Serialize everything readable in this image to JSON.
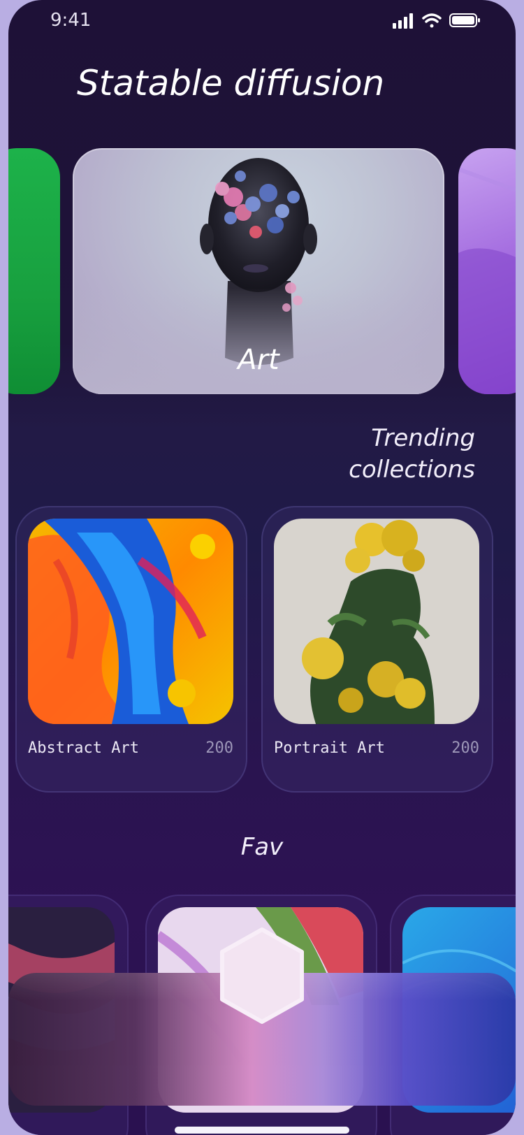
{
  "status": {
    "time": "9:41"
  },
  "header": {
    "title": "Statable diffusion"
  },
  "carousel": {
    "items": [
      {
        "label": "Art"
      }
    ]
  },
  "trending": {
    "title_line1": "Trending",
    "title_line2": "collections",
    "collections": [
      {
        "name": "Abstract Art",
        "count": "200"
      },
      {
        "name": "Portrait Art",
        "count": "200"
      }
    ]
  },
  "fav": {
    "title": "Fav"
  },
  "icons": {
    "signal": "signal-icon",
    "wifi": "wifi-icon",
    "battery": "battery-icon",
    "center": "hexagon-icon"
  },
  "colors": {
    "background": "#1e1337",
    "accent_pink": "#d58ac6",
    "accent_blue": "#2a3aa8",
    "text": "#ffffff"
  }
}
